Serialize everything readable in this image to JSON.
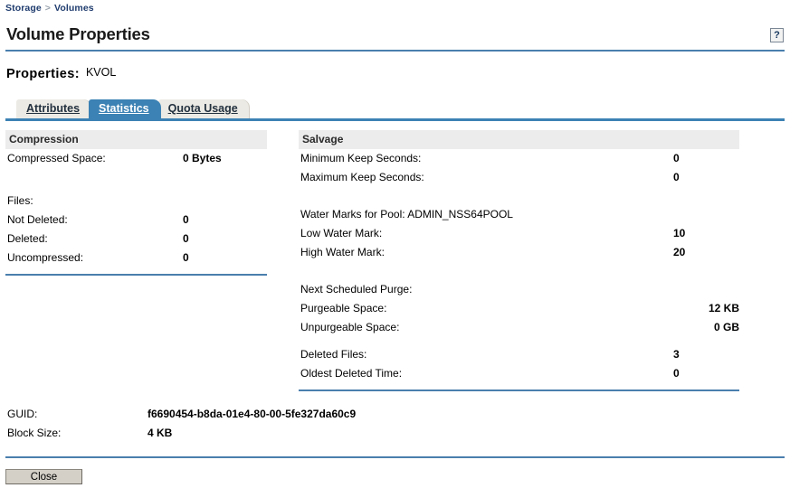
{
  "breadcrumb": {
    "items": [
      "Storage",
      "Volumes"
    ],
    "separator": ">"
  },
  "header": {
    "title": "Volume Properties",
    "help_label": "?"
  },
  "properties": {
    "label": "Properties:",
    "value": "KVOL"
  },
  "tabs": [
    {
      "label": "Attributes",
      "active": false
    },
    {
      "label": "Statistics",
      "active": true
    },
    {
      "label": "Quota Usage",
      "active": false
    }
  ],
  "compression": {
    "section_title": "Compression",
    "rows": [
      {
        "label": "Compressed Space:",
        "value": "0 Bytes"
      }
    ],
    "files_label": "Files:",
    "files_rows": [
      {
        "label": "Not Deleted:",
        "value": "0"
      },
      {
        "label": "Deleted:",
        "value": "0"
      },
      {
        "label": "Uncompressed:",
        "value": "0"
      }
    ]
  },
  "salvage": {
    "section_title": "Salvage",
    "keep_rows": [
      {
        "label": "Minimum Keep Seconds:",
        "value": "0"
      },
      {
        "label": "Maximum Keep Seconds:",
        "value": "0"
      }
    ],
    "water_marks_label": "Water Marks for Pool: ADMIN_NSS64POOL",
    "water_mark_rows": [
      {
        "label": "Low Water Mark:",
        "value": "10"
      },
      {
        "label": "High Water Mark:",
        "value": "20"
      }
    ],
    "purge_label": "Next Scheduled Purge:",
    "purge_rows": [
      {
        "label": "Purgeable Space:",
        "value": "12 KB"
      },
      {
        "label": "Unpurgeable Space:",
        "value": "0 GB"
      }
    ],
    "deleted_rows": [
      {
        "label": "Deleted Files:",
        "value": "3"
      },
      {
        "label": "Oldest Deleted Time:",
        "value": "0"
      }
    ]
  },
  "footer": {
    "rows": [
      {
        "label": "GUID:",
        "value": "f6690454-b8da-01e4-80-00-5fe327da60c9"
      },
      {
        "label": "Block Size:",
        "value": "4 KB"
      }
    ],
    "close_label": "Close"
  },
  "colors": {
    "accent": "#4a7fae",
    "active_tab": "#3c82b4",
    "breadcrumb_text": "#1f3c6e",
    "section_header_bg": "#ececec",
    "button_face": "#d4d0c8"
  }
}
